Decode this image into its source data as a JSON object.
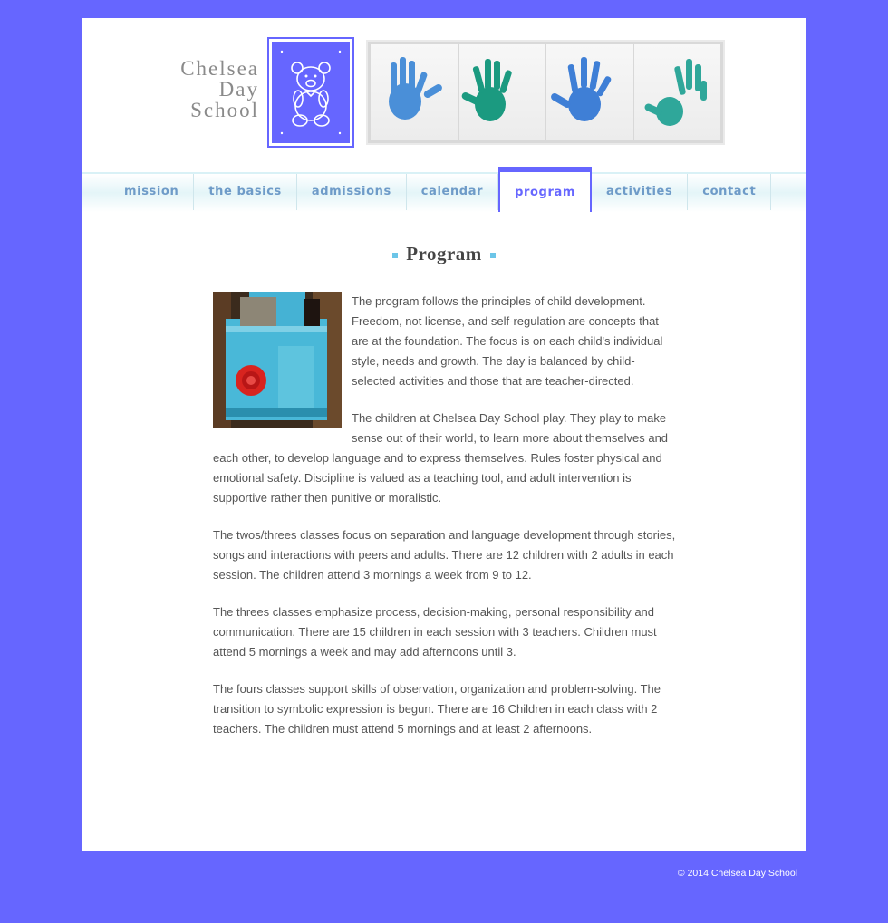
{
  "logo": {
    "line1": "Chelsea",
    "line2": "Day",
    "line3": "School",
    "bear_icon": "teddy-bear-icon",
    "banner": "handprints-banner"
  },
  "nav": {
    "items": [
      {
        "label": "mission"
      },
      {
        "label": "the basics"
      },
      {
        "label": "admissions"
      },
      {
        "label": "calendar"
      },
      {
        "label": "program",
        "active": true
      },
      {
        "label": "activities"
      },
      {
        "label": "contact"
      }
    ]
  },
  "main": {
    "title": "Program",
    "paragraphs": [
      "The program follows the principles of child development. Freedom, not license, and self-regulation are concepts that are at the foundation. The focus is on each child's individual style, needs and growth. The day is balanced by child-selected activities and those that are teacher-directed.",
      "The children at Chelsea Day School play. They play to make sense out of their world, to learn more about themselves and each other, to develop language and to express themselves. Rules foster physical and emotional safety. Discipline is valued as a teaching tool, and adult intervention is supportive rather then punitive or moralistic.",
      "The twos/threes classes focus on separation and language development through stories, songs and interactions with peers and adults. There are 12 children with 2 adults in each session. The children attend 3 mornings a week from 9 to 12.",
      "The threes classes emphasize process, decision-making, personal responsibility and communication. There are 15 children in each session with 3 teachers. Children must attend 5 mornings a week and may add afternoons until 3.",
      "The fours classes support skills of observation, organization and problem-solving. The transition to symbolic expression is begun. There are 16 Children in each class with 2 teachers. The children must attend 5 mornings and at least 2 afternoons."
    ]
  },
  "footer": {
    "copyright": "© 2014 Chelsea Day School"
  },
  "colors": {
    "background": "#6666ff",
    "nav_text": "#6e9bc8",
    "accent": "#6cc5e8"
  }
}
